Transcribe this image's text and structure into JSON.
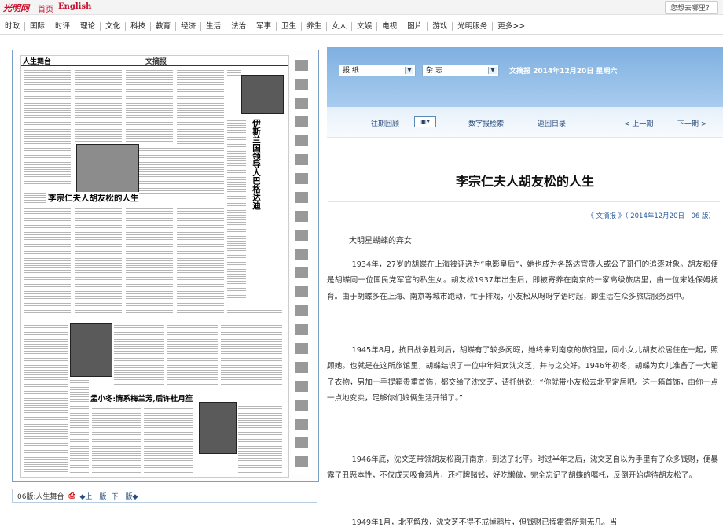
{
  "topbar": {
    "logo": "光明网",
    "home": "首页",
    "english": "English",
    "where_to": "您想去哪里？"
  },
  "nav": [
    "时政",
    "国际",
    "时评",
    "理论",
    "文化",
    "科技",
    "教育",
    "经济",
    "生活",
    "法治",
    "军事",
    "卫生",
    "养生",
    "女人",
    "文娱",
    "电视",
    "图片",
    "游戏",
    "光明服务",
    "更多>>"
  ],
  "newspaper": {
    "section_title": "人生舞台",
    "paper_name": "文摘报",
    "headline_main": "李宗仁夫人胡友松的人生",
    "headline_side": "伊斯兰国领导人巴格达迪",
    "headline_lower": "孟小冬:情系梅兰芳,后许杜月笙"
  },
  "paper_footer": {
    "page_label": "06版:人生舞台",
    "prev": "上一版",
    "next": "下一版"
  },
  "header": {
    "select_paper": "报 纸",
    "select_mag": "杂 志",
    "date_info": "文摘报 2014年12月20日 星期六",
    "past_review": "往期回顾",
    "digital_search": "数字报检索",
    "back_to_toc": "返回目录",
    "prev_issue": "< 上一期",
    "next_issue": "下一期 >"
  },
  "article": {
    "title": "李宗仁夫人胡友松的人生",
    "source": "《 文摘报 》（ 2014年12月20日　06 版）",
    "byline": "大明星蝴蝶的弃女",
    "paragraphs": [
      "1934年，27岁的胡蝶在上海被评选为“电影皇后”，她也成为各路达官贵人或公子哥们的追逐对象。胡友松便是胡蝶同一位国民党军官的私生女。胡友松1937年出生后，即被寄养在南京的一家高级旅店里，由一位宋姓保姆抚育。由于胡蝶多在上海、南京等城市跑动，忙于排戏，小友松从呀呀学语时起，即生活在众多旅店服务员中。",
      "1945年8月，抗日战争胜利后，胡蝶有了较多闲暇，她终来到南京的旅馆里，同小女儿胡友松居住在一起，照顾她。也就是在这所旅馆里，胡蝶结识了一位中年妇女沈文芝，并与之交好。1946年初冬，胡蝶为女儿准备了一大箱子衣物，另加一手提箱贵重首饰，都交给了沈文芝，请托她说：“你就带小友松去北平定居吧。这一箱首饰，由你一点一点地变卖，足够你们娘俩生活开销了。”",
      "1946年底，沈文芝带领胡友松离开南京，到达了北平。时过半年之后，沈文芝自以为手里有了众多钱财，便暴露了丑恶本性，不仅成天吸食鸦片，还打牌赌钱，好吃懒做，完全忘记了胡蝶的嘱托，反倒开始虐待胡友松了。",
      "1949年1月，北平解放，沈文芝不得不戒掉鸦片，但钱财已挥霍得所剩无几。当"
    ]
  }
}
